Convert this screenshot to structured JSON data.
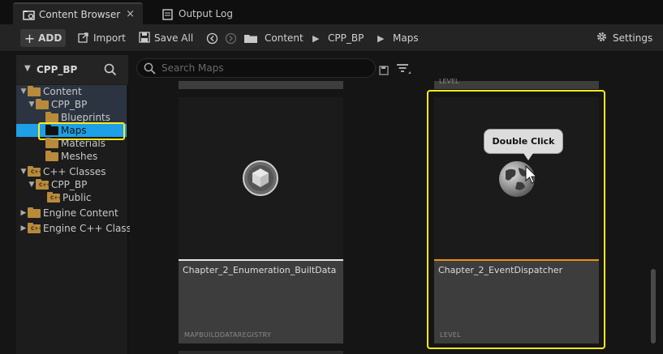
{
  "tabs": [
    {
      "label": "Content Browser",
      "active": true,
      "close": "×"
    },
    {
      "label": "Output Log",
      "active": false
    }
  ],
  "toolbar": {
    "add_label": "ADD",
    "import_label": "Import",
    "save_all_label": "Save All",
    "breadcrumb": [
      "Content",
      "CPP_BP",
      "Maps"
    ],
    "settings_label": "Settings"
  },
  "sidebar": {
    "title": "CPP_BP",
    "tree": [
      {
        "label": "Content"
      },
      {
        "label": "CPP_BP"
      },
      {
        "label": "Blueprints"
      },
      {
        "label": "Maps"
      },
      {
        "label": "Materials"
      },
      {
        "label": "Meshes"
      },
      {
        "label": "C++ Classes"
      },
      {
        "label": "CPP_BP"
      },
      {
        "label": "Public"
      },
      {
        "label": "Engine Content"
      },
      {
        "label": "Engine C++ Class"
      }
    ]
  },
  "search": {
    "placeholder": "Search Maps"
  },
  "assets": [
    {
      "name": "Chapter_2_Enumeration_BuiltData",
      "type": "MAPBUILDDATAREGISTRY"
    },
    {
      "name": "Chapter_2_EventDispatcher",
      "type": "LEVEL"
    }
  ],
  "top_partial_type": "LEVEL",
  "callout": {
    "label": "Double Click"
  },
  "colors": {
    "highlight": "#ffe81a",
    "selected": "#1ea0e6",
    "accent_orange": "#e8940c"
  }
}
